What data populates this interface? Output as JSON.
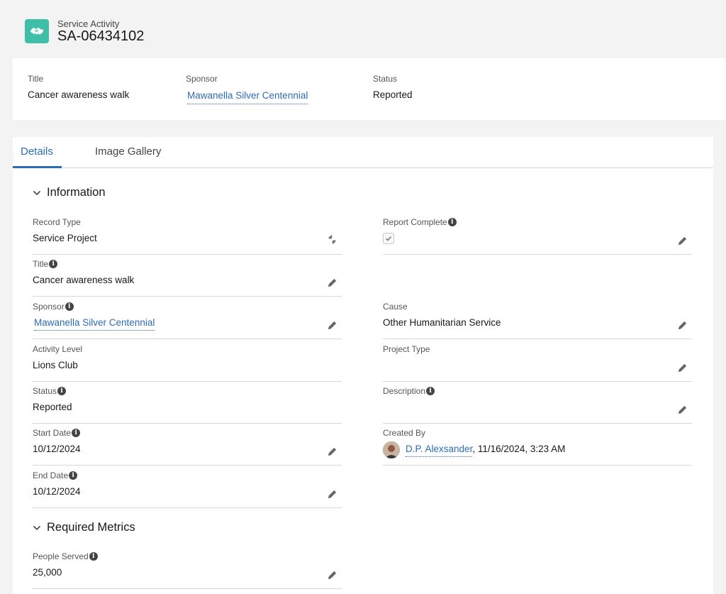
{
  "header": {
    "object_type": "Service Activity",
    "record_name": "SA-06434102",
    "icon": "handshake-icon",
    "icon_color": "#3fbfa8"
  },
  "highlights": {
    "title_label": "Title",
    "title_value": "Cancer awareness walk",
    "sponsor_label": "Sponsor",
    "sponsor_value": "Mawanella Silver Centennial",
    "status_label": "Status",
    "status_value": "Reported"
  },
  "tabs": [
    {
      "label": "Details",
      "active": true
    },
    {
      "label": "Image Gallery",
      "active": false
    }
  ],
  "sections": {
    "information": "Information",
    "required_metrics": "Required Metrics"
  },
  "fields": {
    "record_type": {
      "label": "Record Type",
      "value": "Service Project"
    },
    "title": {
      "label": "Title",
      "value": "Cancer awareness walk"
    },
    "sponsor": {
      "label": "Sponsor",
      "value": "Mawanella Silver Centennial"
    },
    "activity_level": {
      "label": "Activity Level",
      "value": "Lions Club"
    },
    "status": {
      "label": "Status",
      "value": "Reported"
    },
    "start_date": {
      "label": "Start Date",
      "value": "10/12/2024"
    },
    "end_date": {
      "label": "End Date",
      "value": "10/12/2024"
    },
    "report_complete": {
      "label": "Report Complete",
      "checked": true
    },
    "cause": {
      "label": "Cause",
      "value": "Other Humanitarian Service"
    },
    "project_type": {
      "label": "Project Type",
      "value": ""
    },
    "description": {
      "label": "Description",
      "value": ""
    },
    "created_by": {
      "label": "Created By",
      "user": "D.P. Alexsander",
      "timestamp": ", 11/16/2024, 3:23 AM"
    },
    "people_served": {
      "label": "People Served",
      "value": "25,000"
    }
  },
  "colors": {
    "link": "#2c6cb7",
    "active_tab": "#2c6cb7"
  }
}
